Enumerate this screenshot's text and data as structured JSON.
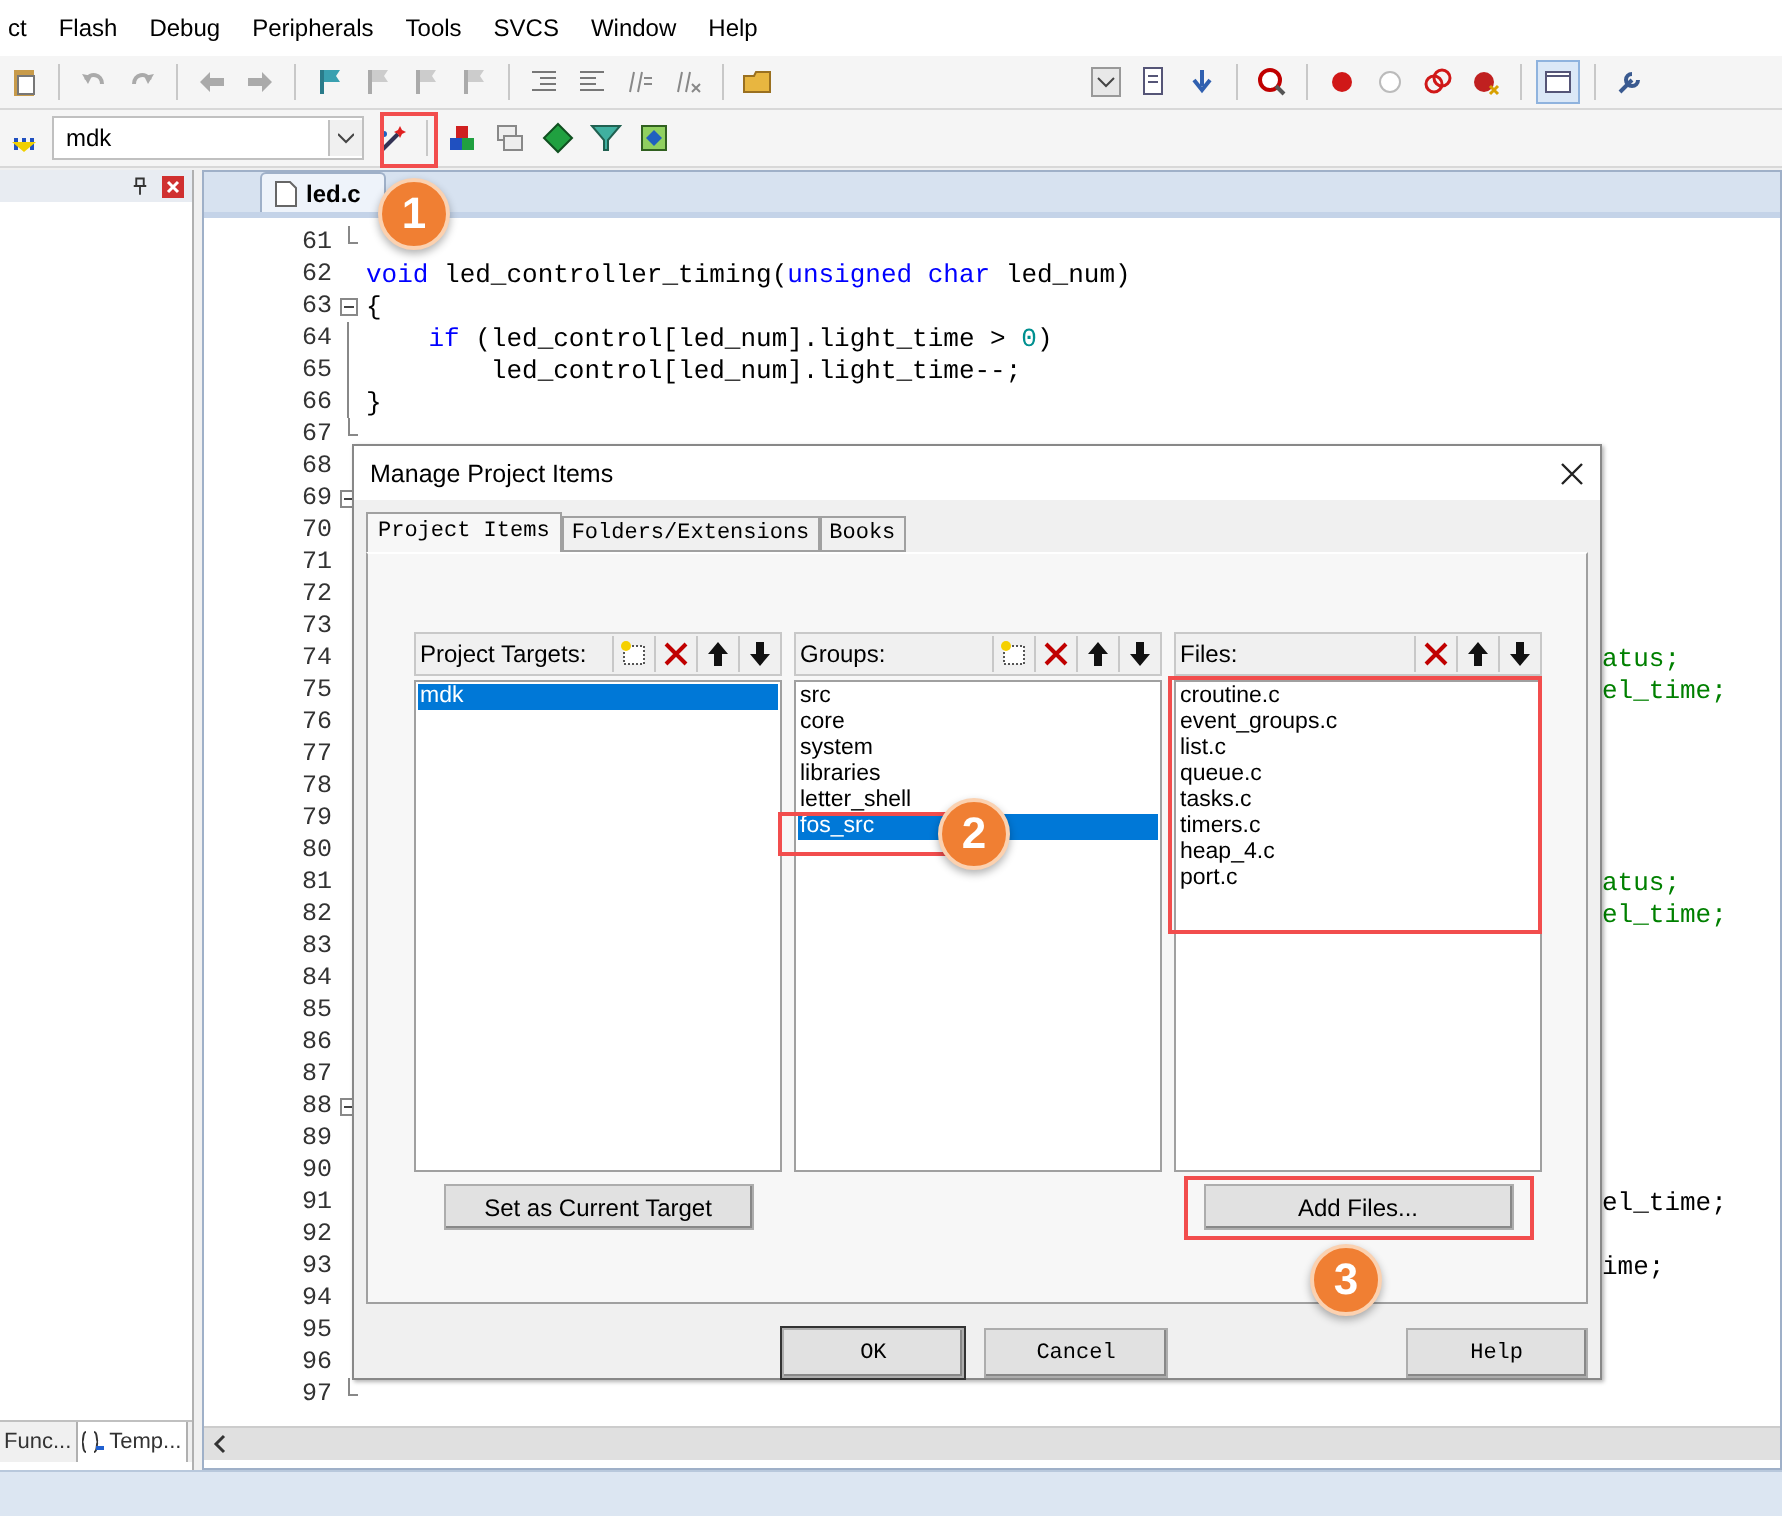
{
  "menu": [
    "ct",
    "Flash",
    "Debug",
    "Peripherals",
    "Tools",
    "SVCS",
    "Window",
    "Help"
  ],
  "toolbar": {
    "target": "mdk"
  },
  "left_panel": {
    "tabs": [
      {
        "label": "Func...",
        "selected": false
      },
      {
        "label": "Temp...",
        "selected": true
      }
    ]
  },
  "editor": {
    "tabs": [
      {
        "label": "led.c",
        "selected": true
      }
    ],
    "lines": [
      {
        "number": "61",
        "kind": "fold-end"
      },
      {
        "number": "62",
        "kind": "plain",
        "tokens": [
          {
            "text": "void",
            "kind": "keyword"
          },
          {
            "text": " led_controller_timing(",
            "kind": "plain"
          },
          {
            "text": "unsigned",
            "kind": "keyword"
          },
          {
            "text": " char",
            "kind": "keyword"
          },
          {
            "text": " led_num)",
            "kind": "plain"
          }
        ]
      },
      {
        "number": "63",
        "kind": "fold-start",
        "tokens": [
          {
            "text": "{",
            "kind": "plain"
          }
        ]
      },
      {
        "number": "64",
        "kind": "fold-line",
        "tokens": [
          {
            "text": "    if",
            "kind": "keyword"
          },
          {
            "text": " (led_control[led_num].light_time > ",
            "kind": "plain"
          },
          {
            "text": "0",
            "kind": "number"
          },
          {
            "text": ")",
            "kind": "plain"
          }
        ]
      },
      {
        "number": "65",
        "kind": "fold-line",
        "tokens": [
          {
            "text": "        led_control[led_num].light_time--;",
            "kind": "plain"
          }
        ]
      },
      {
        "number": "66",
        "kind": "fold-line",
        "tokens": [
          {
            "text": "}",
            "kind": "plain"
          }
        ]
      },
      {
        "number": "67",
        "kind": "fold-end"
      },
      {
        "number": "68",
        "kind": "plain"
      },
      {
        "number": "69",
        "kind": "fold-start"
      },
      {
        "number": "70",
        "kind": "plain"
      },
      {
        "number": "71",
        "kind": "plain"
      },
      {
        "number": "72",
        "kind": "plain"
      },
      {
        "number": "73",
        "kind": "plain"
      },
      {
        "number": "74",
        "kind": "plain",
        "fragment": {
          "text": "atus;",
          "kind": "comment"
        }
      },
      {
        "number": "75",
        "kind": "plain",
        "fragment": {
          "text": "el_time;",
          "kind": "comment"
        }
      },
      {
        "number": "76",
        "kind": "plain"
      },
      {
        "number": "77",
        "kind": "plain"
      },
      {
        "number": "78",
        "kind": "plain"
      },
      {
        "number": "79",
        "kind": "plain"
      },
      {
        "number": "80",
        "kind": "plain"
      },
      {
        "number": "81",
        "kind": "plain",
        "fragment": {
          "text": "atus;",
          "kind": "comment"
        }
      },
      {
        "number": "82",
        "kind": "plain",
        "fragment": {
          "text": "el_time;",
          "kind": "comment"
        }
      },
      {
        "number": "83",
        "kind": "plain"
      },
      {
        "number": "84",
        "kind": "plain"
      },
      {
        "number": "85",
        "kind": "plain"
      },
      {
        "number": "86",
        "kind": "plain"
      },
      {
        "number": "87",
        "kind": "plain"
      },
      {
        "number": "88",
        "kind": "fold-start"
      },
      {
        "number": "89",
        "kind": "plain"
      },
      {
        "number": "90",
        "kind": "plain"
      },
      {
        "number": "91",
        "kind": "plain",
        "fragment": {
          "text": "el_time;",
          "kind": "plain"
        }
      },
      {
        "number": "92",
        "kind": "plain"
      },
      {
        "number": "93",
        "kind": "plain",
        "fragment": {
          "text": "ime;",
          "kind": "plain"
        }
      },
      {
        "number": "94",
        "kind": "plain"
      },
      {
        "number": "95",
        "kind": "plain"
      },
      {
        "number": "96",
        "kind": "plain"
      },
      {
        "number": "97",
        "kind": "fold-end"
      }
    ]
  },
  "dialog": {
    "title": "Manage Project Items",
    "tabs": [
      {
        "label": "Project Items",
        "selected": true
      },
      {
        "label": "Folders/Extensions",
        "selected": false
      },
      {
        "label": "Books",
        "selected": false
      }
    ],
    "lists": [
      {
        "label": "Project Targets:",
        "new_button": true,
        "items": [
          {
            "label": "mdk",
            "selected": true
          }
        ],
        "button": "Set as Current Target"
      },
      {
        "label": "Groups:",
        "new_button": true,
        "items": [
          {
            "label": "src",
            "selected": false
          },
          {
            "label": "core",
            "selected": false
          },
          {
            "label": "system",
            "selected": false
          },
          {
            "label": "libraries",
            "selected": false
          },
          {
            "label": "letter_shell",
            "selected": false
          },
          {
            "label": "fos_src",
            "selected": true
          }
        ]
      },
      {
        "label": "Files:",
        "new_button": false,
        "items": [
          {
            "label": "croutine.c",
            "selected": false
          },
          {
            "label": "event_groups.c",
            "selected": false
          },
          {
            "label": "list.c",
            "selected": false
          },
          {
            "label": "queue.c",
            "selected": false
          },
          {
            "label": "tasks.c",
            "selected": false
          },
          {
            "label": "timers.c",
            "selected": false
          },
          {
            "label": "heap_4.c",
            "selected": false
          },
          {
            "label": "port.c",
            "selected": false
          }
        ],
        "button": "Add Files..."
      }
    ],
    "buttons": [
      "OK",
      "Cancel",
      "Help"
    ]
  },
  "callouts": [
    "1",
    "2",
    "3"
  ]
}
